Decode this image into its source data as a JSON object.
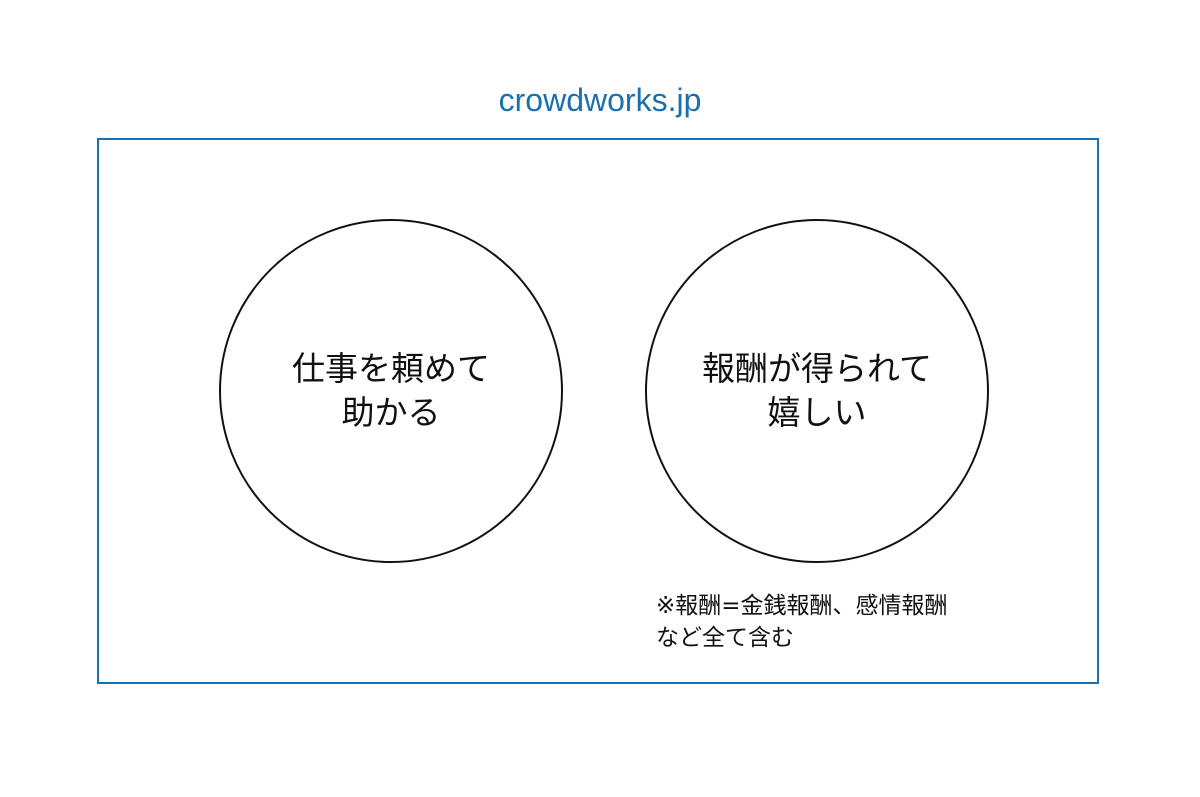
{
  "title": "crowdworks.jp",
  "colors": {
    "accent": "#1a6fb0",
    "stroke": "#111111"
  },
  "left_circle": {
    "line1": "仕事を頼めて",
    "line2": "助かる"
  },
  "right_circle": {
    "line1": "報酬が得られて",
    "line2": "嬉しい"
  },
  "note": {
    "line1": "※報酬=金銭報酬、感情報酬",
    "line2": "など全て含む"
  }
}
